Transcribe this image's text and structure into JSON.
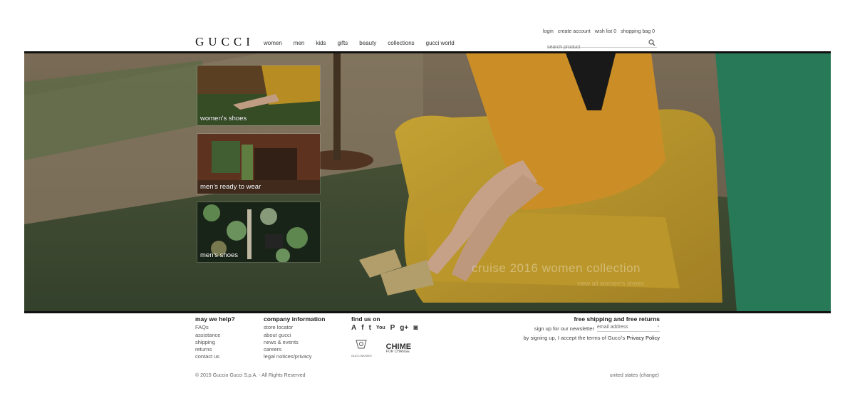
{
  "header": {
    "logo": "GUCCI",
    "nav": [
      "women",
      "men",
      "kids",
      "gifts",
      "beauty",
      "collections",
      "gucci world"
    ],
    "login": "login",
    "create_account": "create account",
    "wish_list": "wish list",
    "wish_count": "0",
    "shopping_bag": "shopping bag",
    "bag_count": "0",
    "search_placeholder": "search product"
  },
  "hero": {
    "tiles": [
      "women's shoes",
      "men's ready to wear",
      "men's shoes"
    ],
    "caption": "cruise 2016 women collection",
    "caption_link": "view all women's shoes"
  },
  "footer": {
    "help": {
      "title": "may we help?",
      "items": [
        "FAQs",
        "assistance",
        "shipping",
        "returns",
        "contact us"
      ]
    },
    "company": {
      "title": "company information",
      "items": [
        "store locator",
        "about gucci",
        "news & events",
        "careers",
        "legal notices/privacy"
      ]
    },
    "find": {
      "title": "find us on",
      "social_icons": [
        "app-store-icon",
        "facebook-icon",
        "twitter-icon",
        "youtube-icon",
        "pinterest-icon",
        "google-plus-icon",
        "instagram-icon"
      ]
    },
    "museo": "GUCCI MUSEO",
    "chime": "CHIME",
    "chime_sub": "FOR CHANGE",
    "shipping_title": "free shipping and free returns",
    "newsletter_label": "sign up for our newsletter",
    "email_placeholder": "email address",
    "terms_prefix": "by signing up, I accept the terms of Gucci's",
    "terms_link": "Privacy Policy",
    "copyright": "© 2015 Guccio Gucci S.p.A. - All Rights Reserved",
    "country": "united states",
    "change": "(change)"
  }
}
